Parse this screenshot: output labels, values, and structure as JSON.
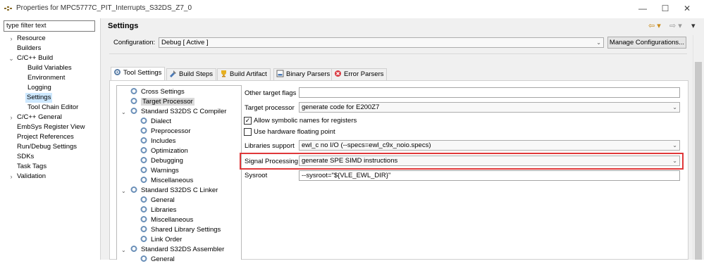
{
  "window": {
    "title": "Properties for MPC5777C_PIT_Interrupts_S32DS_Z7_0",
    "minimize": "—",
    "maximize": "☐",
    "close": "✕"
  },
  "filter": {
    "value": "type filter text"
  },
  "nav": {
    "items": [
      {
        "label": "Resource",
        "expander": "›"
      },
      {
        "label": "Builders",
        "expander": ""
      },
      {
        "label": "C/C++ Build",
        "expander": "⌄"
      },
      {
        "label": "Build Variables",
        "expander": ""
      },
      {
        "label": "Environment",
        "expander": ""
      },
      {
        "label": "Logging",
        "expander": ""
      },
      {
        "label": "Settings",
        "expander": ""
      },
      {
        "label": "Tool Chain Editor",
        "expander": ""
      },
      {
        "label": "C/C++ General",
        "expander": "›"
      },
      {
        "label": "EmbSys Register View",
        "expander": ""
      },
      {
        "label": "Project References",
        "expander": ""
      },
      {
        "label": "Run/Debug Settings",
        "expander": ""
      },
      {
        "label": "SDKs",
        "expander": ""
      },
      {
        "label": "Task Tags",
        "expander": ""
      },
      {
        "label": "Validation",
        "expander": "›"
      }
    ]
  },
  "header": {
    "title": "Settings",
    "back": "⇦ ▾",
    "forward": "⇨ ▾",
    "menu": "▾"
  },
  "configuration": {
    "label": "Configuration:",
    "value": "Debug  [ Active ]",
    "manage_label": "Manage Configurations..."
  },
  "tabs": [
    {
      "label": "Tool Settings",
      "icon": "tool-settings-icon"
    },
    {
      "label": "Build Steps",
      "icon": "build-steps-icon"
    },
    {
      "label": "Build Artifact",
      "icon": "build-artifact-icon"
    },
    {
      "label": "Binary Parsers",
      "icon": "binary-parsers-icon"
    },
    {
      "label": "Error Parsers",
      "icon": "error-parsers-icon"
    }
  ],
  "tree": {
    "items": [
      {
        "label": "Cross Settings"
      },
      {
        "label": "Target Processor"
      },
      {
        "label": "Standard S32DS C Compiler"
      },
      {
        "label": "Dialect"
      },
      {
        "label": "Preprocessor"
      },
      {
        "label": "Includes"
      },
      {
        "label": "Optimization"
      },
      {
        "label": "Debugging"
      },
      {
        "label": "Warnings"
      },
      {
        "label": "Miscellaneous"
      },
      {
        "label": "Standard S32DS C Linker"
      },
      {
        "label": "General"
      },
      {
        "label": "Libraries"
      },
      {
        "label": "Miscellaneous"
      },
      {
        "label": "Shared Library Settings"
      },
      {
        "label": "Link Order"
      },
      {
        "label": "Standard S32DS Assembler"
      },
      {
        "label": "General"
      }
    ]
  },
  "form": {
    "other_flags": {
      "label": "Other target flags",
      "value": ""
    },
    "target_processor": {
      "label": "Target processor",
      "value": "generate code for E200Z7"
    },
    "allow_symbolic": {
      "label": "Allow symbolic names for registers",
      "checked": "✓"
    },
    "hw_float": {
      "label": "Use hardware floating point",
      "checked": ""
    },
    "libraries_support": {
      "label": "Libraries support",
      "value": "ewl_c no I/O (--specs=ewl_c9x_noio.specs)"
    },
    "signal_processing": {
      "label": "Signal Processing",
      "value": "generate SPE SIMD instructions"
    },
    "sysroot": {
      "label": "Sysroot",
      "value": "--sysroot=\"${VLE_EWL_DIR}\""
    }
  },
  "colors": {
    "highlight_border": "#e0383a",
    "selection": "#cde8ff",
    "accent_arrows": "#c98a1a"
  }
}
